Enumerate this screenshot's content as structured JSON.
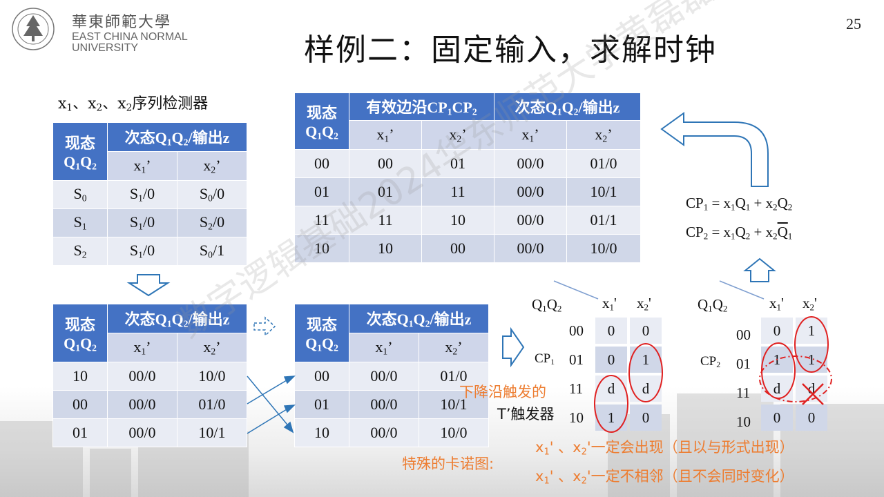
{
  "header": {
    "school_cn": "華東師範大學",
    "school_en_1": "EAST CHINA NORMAL",
    "school_en_2": "UNIVERSITY",
    "page_number": "25",
    "title": "样例二：固定输入，求解时钟"
  },
  "watermark": "数字逻辑基础2024华东师范大学黄磊磊",
  "colors": {
    "header_blue": "#4472c4",
    "row_light": "#e9ecf4",
    "row_dark": "#d0d7e8",
    "orange": "#ed7d31",
    "circle_red": "#e02020"
  },
  "seq": {
    "title": [
      "x",
      "1",
      "、x",
      "2",
      "、x",
      "2",
      "序列检测器"
    ],
    "hdr": [
      "现态",
      "Q",
      "1",
      "Q",
      "2",
      "次态Q",
      "1",
      "Q",
      "2",
      "/输出z",
      "x",
      "1",
      "’",
      "x",
      "2",
      "’"
    ],
    "rows": [
      [
        "S",
        "0",
        "S",
        "1",
        "/0",
        "S",
        "0",
        "/0"
      ],
      [
        "S",
        "1",
        "S",
        "1",
        "/0",
        "S",
        "2",
        "/0"
      ],
      [
        "S",
        "2",
        "S",
        "1",
        "/0",
        "S",
        "0",
        "/1"
      ]
    ]
  },
  "enc": {
    "rows": [
      [
        "10",
        "00/0",
        "10/0"
      ],
      [
        "00",
        "00/0",
        "01/0"
      ],
      [
        "01",
        "00/0",
        "10/1"
      ]
    ]
  },
  "reord": {
    "rows": [
      [
        "00",
        "00/0",
        "01/0"
      ],
      [
        "01",
        "00/0",
        "10/1"
      ],
      [
        "10",
        "00/0",
        "10/0"
      ]
    ]
  },
  "cp": {
    "hdr": [
      "有效边沿CP",
      "1",
      "CP",
      "2",
      "次态Q",
      "1",
      "Q",
      "2",
      "/输出z"
    ],
    "rows": [
      [
        "00",
        "00",
        "01",
        "00/0",
        "01/0"
      ],
      [
        "01",
        "01",
        "11",
        "00/0",
        "10/1"
      ],
      [
        "11",
        "11",
        "10",
        "00/0",
        "01/1"
      ],
      [
        "10",
        "10",
        "00",
        "00/0",
        "10/0"
      ]
    ]
  },
  "eq": {
    "cp1": [
      "CP",
      "1",
      " = x",
      "1",
      "Q",
      "1",
      " + x",
      "2",
      "Q",
      "2"
    ],
    "cp2": [
      "CP",
      "2",
      " = x",
      "1",
      "Q",
      "2",
      " + x",
      "2",
      "Q",
      "1"
    ]
  },
  "kmap1": {
    "label": [
      "CP",
      "1"
    ],
    "rows": [
      "00",
      "01",
      "11",
      "10"
    ],
    "col1": [
      "0",
      "0",
      "d",
      "1"
    ],
    "col2": [
      "0",
      "1",
      "d",
      "0"
    ]
  },
  "kmap2": {
    "label": [
      "CP",
      "2"
    ],
    "rows": [
      "00",
      "01",
      "11",
      "10"
    ],
    "col1": [
      "0",
      "1",
      "d",
      "0"
    ],
    "col2": [
      "1",
      "1",
      "d",
      "0"
    ]
  },
  "notes": {
    "trigger_1": "下降沿触发的",
    "trigger_2": "T’触发器",
    "special": "特殊的卡诺图:",
    "line1": "'一定会出现（且以与形式出现）",
    "line2": "'一定不相邻（且不会同时变化）",
    "sep": "' 、x"
  }
}
